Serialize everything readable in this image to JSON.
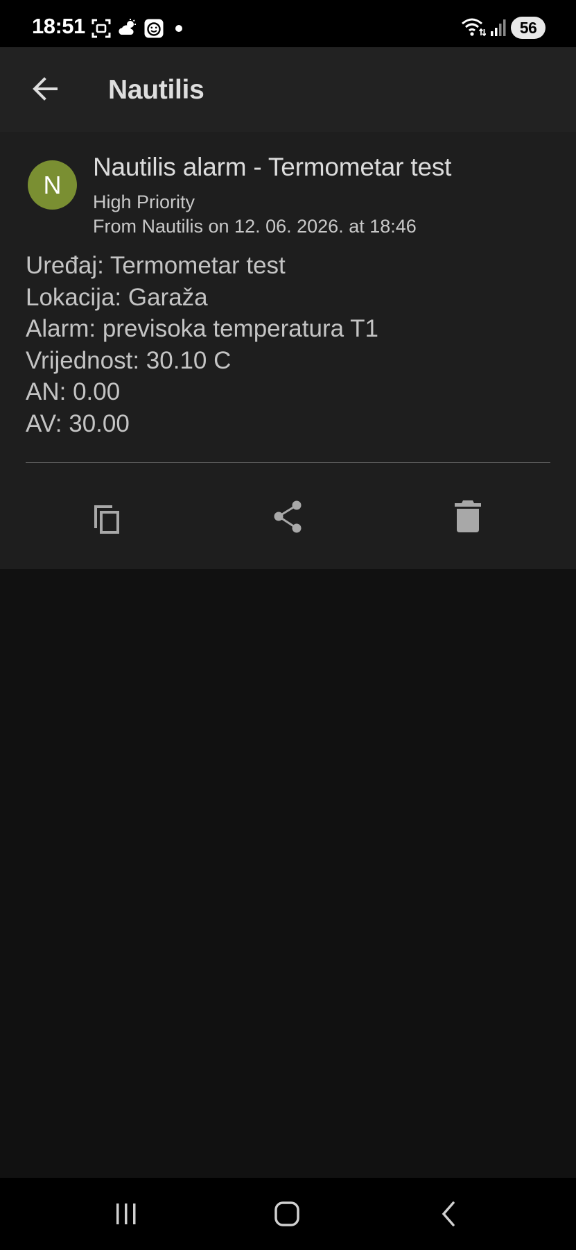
{
  "status_bar": {
    "time": "18:51",
    "battery": "56",
    "left_icons": [
      "screenshot-icon",
      "weather-icon",
      "face-icon",
      "notification-dot-icon"
    ],
    "right_icons": [
      "wifi-icon",
      "signal-icon",
      "battery-icon"
    ]
  },
  "app_bar": {
    "title": "Nautilis",
    "back_icon": "arrow-left-icon"
  },
  "notification": {
    "avatar_letter": "N",
    "avatar_color": "#7a8f32",
    "title": "Nautilis alarm - Termometar test",
    "priority": "High Priority",
    "from": "From Nautilis on 12. 06. 2026. at 18:46",
    "body_lines": [
      "Uređaj: Termometar test",
      "Lokacija: Garaža",
      "Alarm: previsoka temperatura T1",
      "Vrijednost: 30.10 C",
      "AN: 0.00",
      "AV: 30.00"
    ],
    "actions": [
      "copy-icon",
      "share-icon",
      "delete-icon"
    ]
  },
  "nav_bar": {
    "buttons": [
      "recents-icon",
      "home-icon",
      "back-icon"
    ]
  },
  "colors": {
    "background": "#111111",
    "app_bar": "#222222",
    "card": "#1e1e1e",
    "status_bar": "#000000"
  }
}
